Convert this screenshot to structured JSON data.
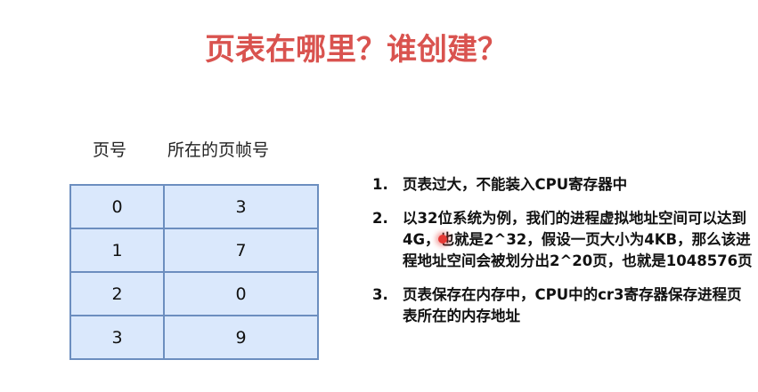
{
  "title": "页表在哪里？谁创建？",
  "table": {
    "headers": [
      "页号",
      "所在的页帧号"
    ],
    "rows": [
      [
        "0",
        "3"
      ],
      [
        "1",
        "7"
      ],
      [
        "2",
        "0"
      ],
      [
        "3",
        "9"
      ]
    ]
  },
  "points": [
    {
      "num": "1.",
      "text": "页表过大，不能装入CPU寄存器中"
    },
    {
      "num": "2.",
      "text": "以32位系统为例，我们的进程虚拟地址空间可以达到4G，也就是2^32，假设一页大小为4KB，那么该进程地址空间会被划分出2^20页，也就是1048576页"
    },
    {
      "num": "3.",
      "text": "页表保存在内存中，CPU中的cr3寄存器保存进程页表所在的内存地址"
    }
  ],
  "colors": {
    "title": "#d9534f",
    "cell_fill": "#dae8fc",
    "cell_border": "#6c8ebf"
  }
}
